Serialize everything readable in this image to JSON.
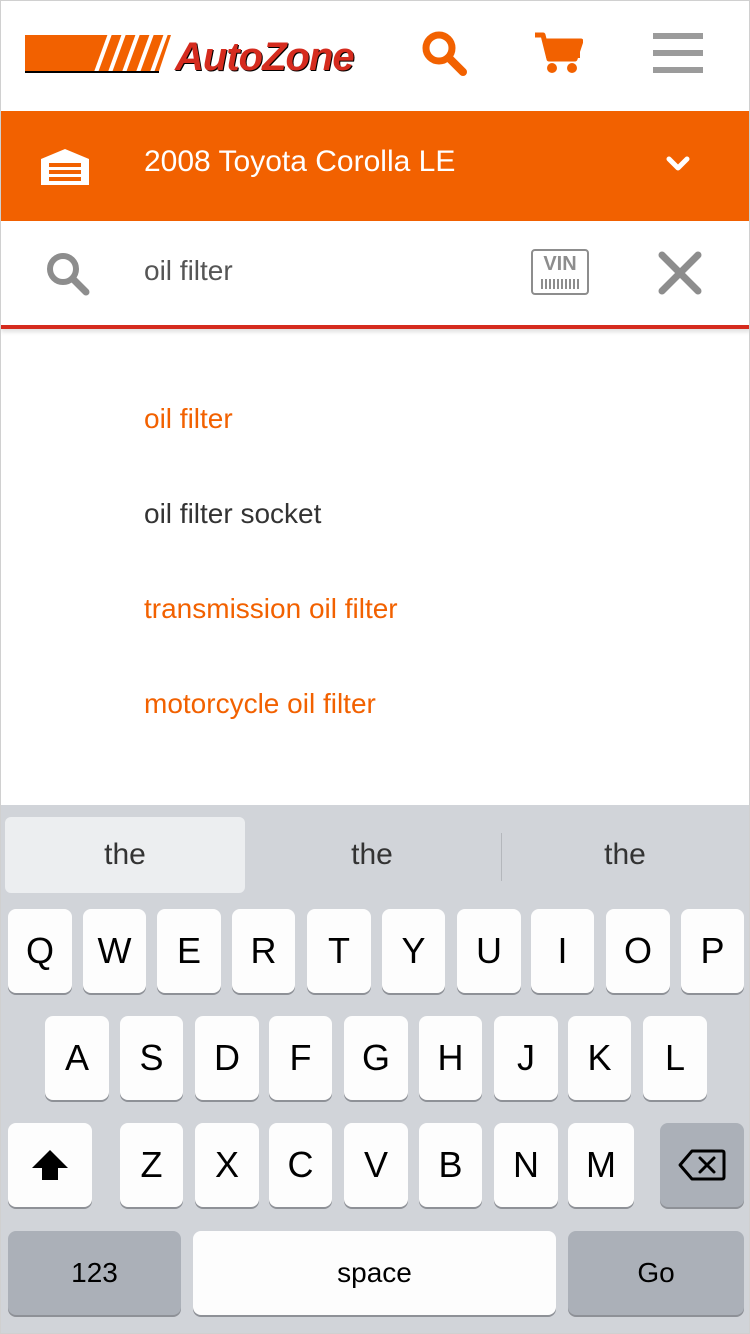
{
  "header": {
    "logo_text": "AutoZone",
    "search_icon": "search-icon",
    "cart_icon": "cart-icon",
    "menu_icon": "hamburger-menu-icon",
    "accent_color": "#f26100",
    "logo_red": "#d52b1e"
  },
  "vehicle": {
    "name": "2008 Toyota Corolla LE",
    "icon": "garage-icon",
    "chevron": "chevron-down-icon",
    "bar_color": "#f26100"
  },
  "search": {
    "value": "oil filter",
    "vin_label": "VIN",
    "clear_icon": "close-icon"
  },
  "suggestions": [
    {
      "text": "oil filter",
      "style": "accent"
    },
    {
      "text": "oil filter socket",
      "style": "plain"
    },
    {
      "text": "transmission oil filter",
      "style": "accent"
    },
    {
      "text": "motorcycle oil filter",
      "style": "accent"
    }
  ],
  "keyboard": {
    "predictions": [
      "the",
      "the",
      "the"
    ],
    "row1": [
      "Q",
      "W",
      "E",
      "R",
      "T",
      "Y",
      "U",
      "I",
      "O",
      "P"
    ],
    "row2": [
      "A",
      "S",
      "D",
      "F",
      "G",
      "H",
      "J",
      "K",
      "L"
    ],
    "row3": [
      "Z",
      "X",
      "C",
      "V",
      "B",
      "N",
      "M"
    ],
    "shift_icon": "shift-icon",
    "delete_icon": "backspace-icon",
    "numbers_label": "123",
    "space_label": "space",
    "go_label": "Go"
  }
}
